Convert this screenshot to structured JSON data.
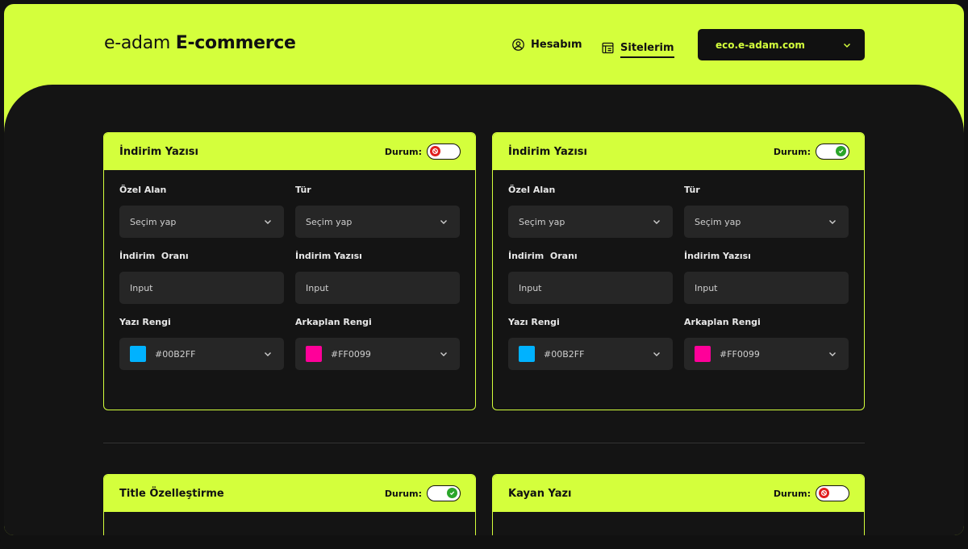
{
  "header": {
    "logo_light": "e-adam",
    "logo_bold": "E-commerce",
    "nav": {
      "account_label": "Hesabım",
      "sites_label": "Sitelerim"
    },
    "site_select": {
      "value": "eco.e-adam.com"
    }
  },
  "colors": {
    "accent": "#d4ff3c",
    "background": "#141414",
    "input_bg": "#262626",
    "status_off": "#e01e1e",
    "status_on": "#2aa52a"
  },
  "cards": [
    {
      "title": "İndirim Yazısı",
      "status_label": "Durum:",
      "status": "off",
      "fields": {
        "ozel_alan": {
          "label": "Özel Alan",
          "value": "Seçim yap"
        },
        "tur": {
          "label": "Tür",
          "value": "Seçim yap"
        },
        "indirim_orani": {
          "label": "İndirim  Oranı",
          "placeholder": "Input"
        },
        "indirim_yazisi": {
          "label": "İndirim Yazısı",
          "placeholder": "Input"
        },
        "yazi_rengi": {
          "label": "Yazı Rengi",
          "value": "#00B2FF",
          "color": "#00B2FF"
        },
        "arkaplan_rengi": {
          "label": "Arkaplan Rengi",
          "value": "#FF0099",
          "color": "#FF0099"
        }
      }
    },
    {
      "title": "İndirim Yazısı",
      "status_label": "Durum:",
      "status": "on",
      "fields": {
        "ozel_alan": {
          "label": "Özel Alan",
          "value": "Seçim yap"
        },
        "tur": {
          "label": "Tür",
          "value": "Seçim yap"
        },
        "indirim_orani": {
          "label": "İndirim  Oranı",
          "placeholder": "Input"
        },
        "indirim_yazisi": {
          "label": "İndirim Yazısı",
          "placeholder": "Input"
        },
        "yazi_rengi": {
          "label": "Yazı Rengi",
          "value": "#00B2FF",
          "color": "#00B2FF"
        },
        "arkaplan_rengi": {
          "label": "Arkaplan Rengi",
          "value": "#FF0099",
          "color": "#FF0099"
        }
      }
    },
    {
      "title": "Title Özelleştirme",
      "status_label": "Durum:",
      "status": "on"
    },
    {
      "title": "Kayan Yazı",
      "status_label": "Durum:",
      "status": "off"
    }
  ]
}
